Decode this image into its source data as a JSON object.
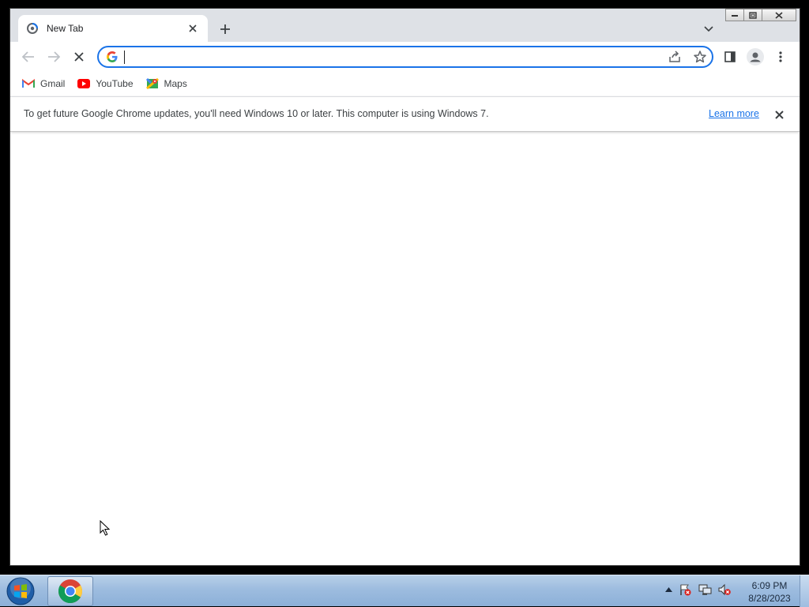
{
  "tabs": [
    {
      "title": "New Tab",
      "active": true
    }
  ],
  "omnibox": {
    "value": "",
    "placeholder": ""
  },
  "bookmarks": [
    {
      "label": "Gmail",
      "icon": "gmail-icon"
    },
    {
      "label": "YouTube",
      "icon": "youtube-icon"
    },
    {
      "label": "Maps",
      "icon": "maps-icon"
    }
  ],
  "infobar": {
    "message": "To get future Google Chrome updates, you'll need Windows 10 or later. This computer is using Windows 7.",
    "link": "Learn more"
  },
  "taskbar": {
    "time": "6:09 PM",
    "date": "8/28/2023",
    "apps": [
      "chrome-icon"
    ]
  },
  "colors": {
    "accent": "#1a73e8",
    "tabstrip": "#dee1e6"
  }
}
